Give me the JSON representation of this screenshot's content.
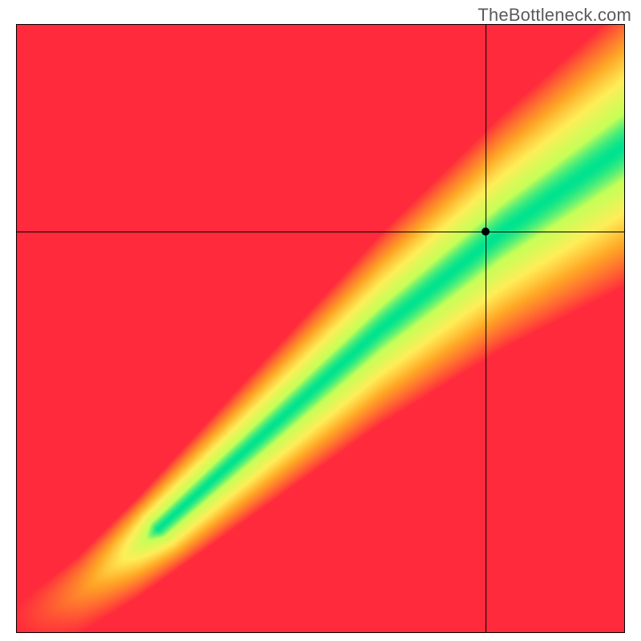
{
  "watermark": "TheBottleneck.com",
  "chart_data": {
    "type": "heatmap",
    "title": "",
    "xlabel": "",
    "ylabel": "",
    "xlim": [
      0,
      100
    ],
    "ylim": [
      0,
      100
    ],
    "marker": {
      "x": 77,
      "y": 66
    },
    "crosshair": {
      "x": 77,
      "y": 66
    },
    "optimal_curve": [
      {
        "x": 0,
        "y": 0
      },
      {
        "x": 10,
        "y": 6
      },
      {
        "x": 20,
        "y": 14
      },
      {
        "x": 30,
        "y": 23
      },
      {
        "x": 40,
        "y": 32
      },
      {
        "x": 50,
        "y": 41
      },
      {
        "x": 60,
        "y": 50
      },
      {
        "x": 70,
        "y": 58
      },
      {
        "x": 80,
        "y": 66
      },
      {
        "x": 90,
        "y": 73
      },
      {
        "x": 100,
        "y": 80
      }
    ],
    "color_stops": [
      {
        "t": 0.0,
        "color": "#ff2a3c"
      },
      {
        "t": 0.45,
        "color": "#ffa726"
      },
      {
        "t": 0.7,
        "color": "#ffee58"
      },
      {
        "t": 0.9,
        "color": "#c6ff58"
      },
      {
        "t": 1.0,
        "color": "#00e38f"
      }
    ],
    "band_halfwidth": 6.5,
    "band_exponent": 1.6
  }
}
